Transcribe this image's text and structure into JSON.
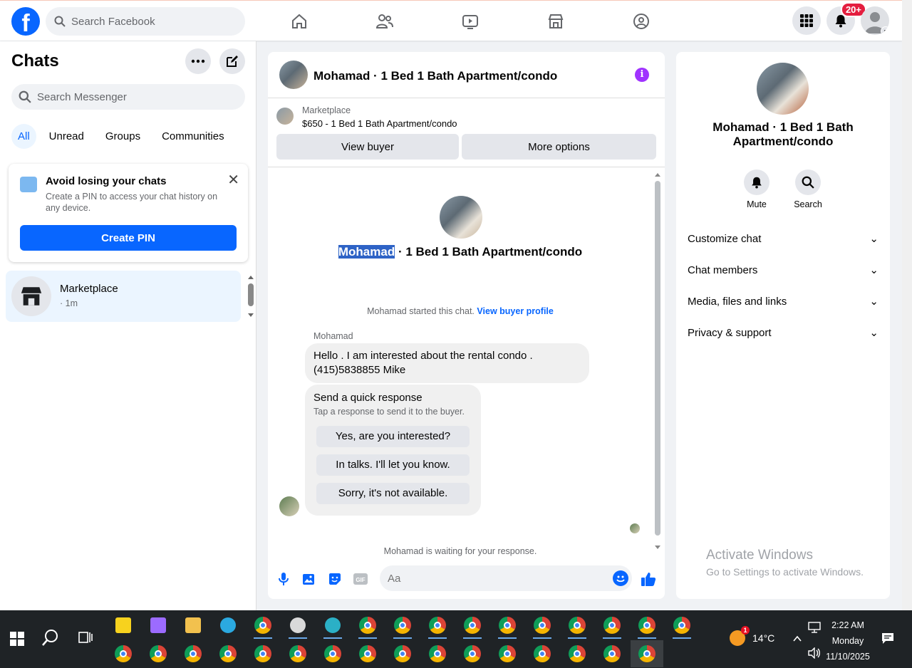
{
  "topbar": {
    "search_placeholder": "Search Facebook",
    "nav": [
      "home-icon",
      "friends-icon",
      "video-icon",
      "marketplace-icon",
      "groups-icon"
    ],
    "notifications_badge": "20+"
  },
  "sidebar": {
    "title": "Chats",
    "search_placeholder": "Search Messenger",
    "tabs": [
      {
        "label": "All",
        "active": true
      },
      {
        "label": "Unread"
      },
      {
        "label": "Groups"
      },
      {
        "label": "Communities"
      }
    ],
    "pin_card": {
      "title": "Avoid losing your chats",
      "description": "Create a PIN to access your chat history on any device.",
      "button": "Create PIN"
    },
    "chats": [
      {
        "name": "Marketplace",
        "time": "· 1m"
      }
    ]
  },
  "chat": {
    "header_title": "Mohamad · 1 Bed 1 Bath Apartment/condo",
    "marketplace": {
      "label": "Marketplace",
      "listing": "$650 - 1 Bed 1 Bath Apartment/condo",
      "view_buyer": "View buyer",
      "more_options": "More options"
    },
    "intro_name": "Mohamad",
    "intro_rest": " · 1 Bed 1 Bath Apartment/condo",
    "started_text": "Mohamad started this chat.",
    "view_buyer_profile": "View buyer profile",
    "sender": "Mohamad",
    "message": "Hello . I am interested about the rental condo . (415)5838855 Mike",
    "quick_response": {
      "title": "Send a quick response",
      "subtitle": "Tap a response to send it to the buyer.",
      "options": [
        "Yes, are you interested?",
        "In talks. I'll let you know.",
        "Sorry, it's not available."
      ]
    },
    "waiting": "Mohamad is waiting for your response.",
    "composer_placeholder": "Aa",
    "gif_label": "GIF"
  },
  "details": {
    "title": "Mohamad · 1 Bed 1 Bath Apartment/condo",
    "actions": [
      {
        "label": "Mute",
        "icon": "bell-icon"
      },
      {
        "label": "Search",
        "icon": "search-icon"
      }
    ],
    "sections": [
      "Customize chat",
      "Chat members",
      "Media, files and links",
      "Privacy & support"
    ],
    "watermark_title": "Activate Windows",
    "watermark_sub": "Go to Settings to activate Windows."
  },
  "taskbar": {
    "temperature": "14°C",
    "time": "2:22 AM",
    "day": "Monday",
    "date": "11/10/2025",
    "weather_alerts": "1"
  },
  "colors": {
    "brand": "#0866ff",
    "info": "#a033ff",
    "badge": "#e41e3f"
  }
}
